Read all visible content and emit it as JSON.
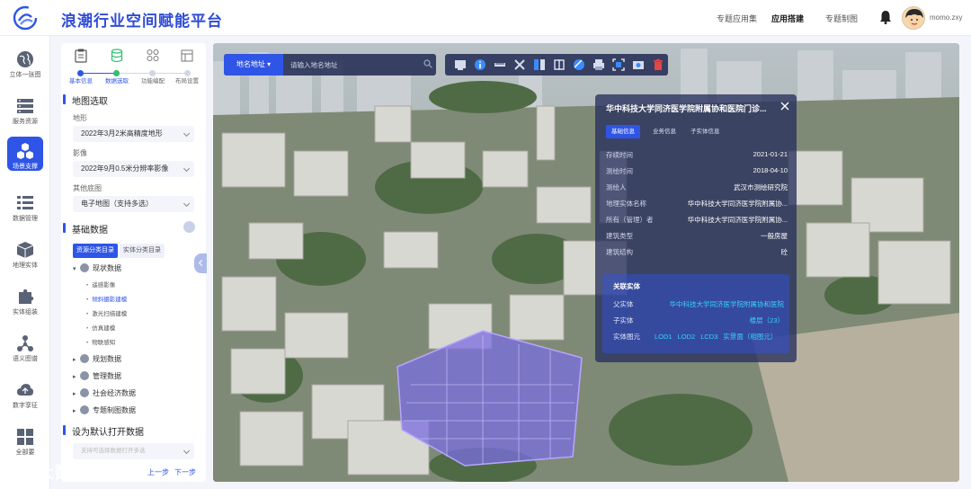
{
  "header": {
    "title": "浪潮行业空间赋能平台",
    "nav": [
      "专题应用集",
      "应用搭建",
      "专题制图"
    ],
    "active_nav": "应用搭建",
    "username": "momo.zxy"
  },
  "sidebar": {
    "items": [
      {
        "label": "立体一张图",
        "icon": "globe-icon"
      },
      {
        "label": "服务资源",
        "icon": "server-icon"
      },
      {
        "label": "场景支撑",
        "icon": "cubes-icon",
        "active": true
      },
      {
        "label": "数据管理",
        "icon": "list-icon"
      },
      {
        "label": "地理实体",
        "icon": "box-icon"
      },
      {
        "label": "实体组装",
        "icon": "puzzle-icon"
      },
      {
        "label": "语义图谱",
        "icon": "graph-icon"
      },
      {
        "label": "数字孪征",
        "icon": "cloud-icon"
      },
      {
        "label": "全部要",
        "icon": "grid-icon"
      }
    ]
  },
  "panel": {
    "steps": [
      "基本信息",
      "数据选取",
      "功能编配",
      "布局设置"
    ],
    "map_section": {
      "title": "地图选取",
      "terrain_label": "地形",
      "terrain_value": "2022年3月2米高精度地形",
      "imagery_label": "影像",
      "imagery_value": "2022年9月0.5米分辨率影像",
      "basemap_label": "其他底图",
      "basemap_value": "电子地图（支持多选）"
    },
    "base_data": {
      "title": "基础数据",
      "tabs": [
        "资源分类目录",
        "实体分类目录"
      ],
      "tree": [
        {
          "label": "现状数据",
          "expanded": true,
          "children": [
            "遥感影像",
            "倾斜摄影建模",
            "激光扫描建模",
            "仿真建模",
            "物联感知"
          ]
        },
        {
          "label": "规划数据"
        },
        {
          "label": "管理数据"
        },
        {
          "label": "社会经济数据"
        },
        {
          "label": "专题制图数据"
        }
      ],
      "active_leaf": "倾斜摄影建模"
    },
    "default_section": {
      "title": "设为默认打开数据",
      "placeholder": "支持可选择数据打开多选"
    },
    "pager": {
      "prev": "上一步",
      "next": "下一步"
    }
  },
  "map": {
    "search_type": "地名地址",
    "search_placeholder": "请输入地名地址",
    "tools": [
      "screen-icon",
      "info-icon",
      "ruler-icon",
      "cross-icon",
      "split-icon",
      "compare-icon",
      "slice-icon",
      "print-icon",
      "frame-icon",
      "camera-icon",
      "trash-icon"
    ]
  },
  "info_panel": {
    "title": "华中科技大学同济医学院附属协和医院门诊...",
    "tabs": [
      "基础信息",
      "业务信息",
      "子实体信息"
    ],
    "rows": [
      {
        "k": "存续时间",
        "v": "2021-01-21"
      },
      {
        "k": "测绘时间",
        "v": "2018-04-10"
      },
      {
        "k": "测绘人",
        "v": "武汉市测绘研究院"
      },
      {
        "k": "地理实体名称",
        "v": "华中科技大学同济医学院附属协..."
      },
      {
        "k": "所有（管理）者",
        "v": "华中科技大学同济医学院附属协..."
      },
      {
        "k": "建筑类型",
        "v": "一般房屋"
      },
      {
        "k": "建筑结构",
        "v": "砼"
      }
    ],
    "related": {
      "title": "关联实体",
      "parent_label": "父实体",
      "parent_value": "华中科技大学同济医学院附属协和医院",
      "child_label": "子实体",
      "child_value": "楼层（23）",
      "graphic_label": "实体图元",
      "graphic_values": [
        "LOD1",
        "LOD2",
        "LCD3",
        "实景面（相图元）"
      ]
    }
  },
  "watermark": {
    "text": "大数跨境"
  },
  "colors": {
    "primary": "#2f55e6",
    "accent": "#36d3ff",
    "panel_bg": "#28305c"
  }
}
